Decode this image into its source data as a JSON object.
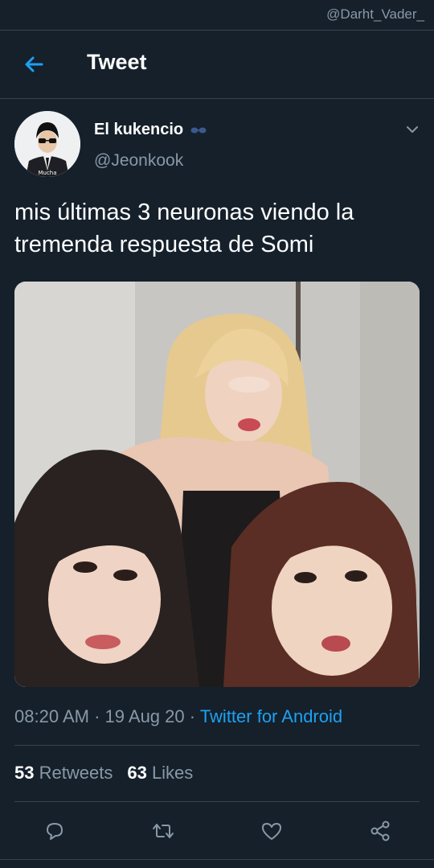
{
  "watermark": "@Darht_Vader_",
  "header": {
    "title": "Tweet"
  },
  "author": {
    "name": "El kukencio",
    "handle": "@Jeonkook",
    "avatar_caption": "Mucha"
  },
  "tweet": {
    "text": "mis últimas 3 neuronas viendo la tremenda respuesta de Somi",
    "time": "08:20 AM",
    "date": "19 Aug 20",
    "source": "Twitter for Android"
  },
  "stats": {
    "retweets_count": "53",
    "retweets_label": "Retweets",
    "likes_count": "63",
    "likes_label": "Likes"
  },
  "actions": [
    {
      "icon": "reply-icon"
    },
    {
      "icon": "retweet-icon"
    },
    {
      "icon": "like-icon"
    },
    {
      "icon": "share-icon"
    }
  ],
  "colors": {
    "background": "#15202b",
    "accent": "#1da1f2",
    "secondary_text": "#8899a6",
    "divider": "#38444d"
  }
}
